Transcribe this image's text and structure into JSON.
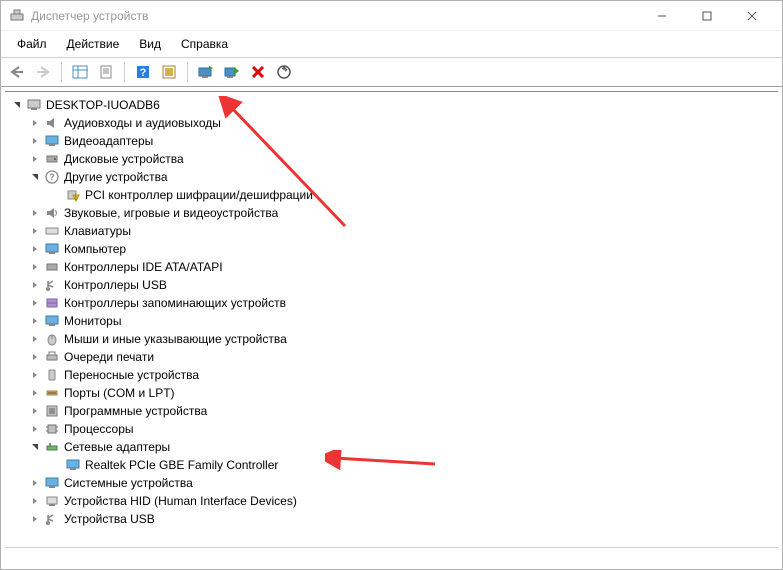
{
  "window": {
    "title": "Диспетчер устройств"
  },
  "menu": {
    "file": "Файл",
    "action": "Действие",
    "view": "Вид",
    "help": "Справка"
  },
  "tree": {
    "root": "DESKTOP-IUOADB6",
    "cat_audio": "Аудиовходы и аудиовыходы",
    "cat_video": "Видеоадаптеры",
    "cat_disk": "Дисковые устройства",
    "cat_other": "Другие устройства",
    "item_pci": "PCI контроллер шифрации/дешифрации",
    "cat_sound": "Звуковые, игровые и видеоустройства",
    "cat_keyboard": "Клавиатуры",
    "cat_computer": "Компьютер",
    "cat_ide": "Контроллеры IDE ATA/ATAPI",
    "cat_usbctrl": "Контроллеры USB",
    "cat_storage": "Контроллеры запоминающих устройств",
    "cat_monitor": "Мониторы",
    "cat_mouse": "Мыши и иные указывающие устройства",
    "cat_printq": "Очереди печати",
    "cat_portable": "Переносные устройства",
    "cat_ports": "Порты (COM и LPT)",
    "cat_software": "Программные устройства",
    "cat_cpu": "Процессоры",
    "cat_net": "Сетевые адаптеры",
    "item_realtek": "Realtek PCIe GBE Family Controller",
    "cat_system": "Системные устройства",
    "cat_hid": "Устройства HID (Human Interface Devices)",
    "cat_usbdev": "Устройства USB"
  }
}
